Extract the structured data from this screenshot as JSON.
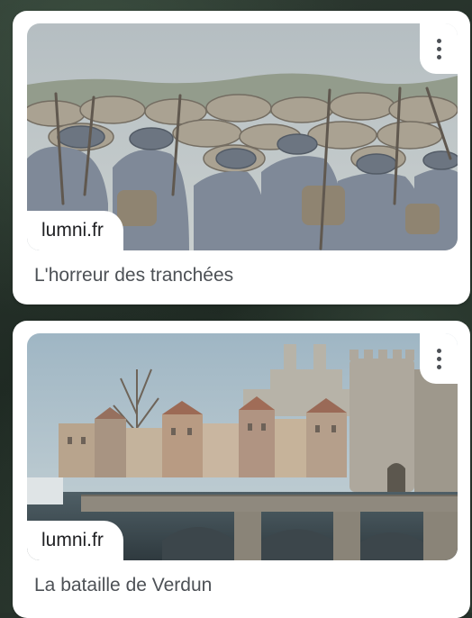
{
  "results": [
    {
      "source": "lumni.fr",
      "title": "L'horreur des tranchées",
      "menu_icon": "more-vert-icon",
      "image_desc": "colorized WWI soldiers in helmets crouching behind sandbag trench wall"
    },
    {
      "source": "lumni.fr",
      "title": "La bataille de Verdun",
      "menu_icon": "more-vert-icon",
      "image_desc": "colorized town of Verdun with cathedral, round towers and stone bridge over river"
    }
  ]
}
